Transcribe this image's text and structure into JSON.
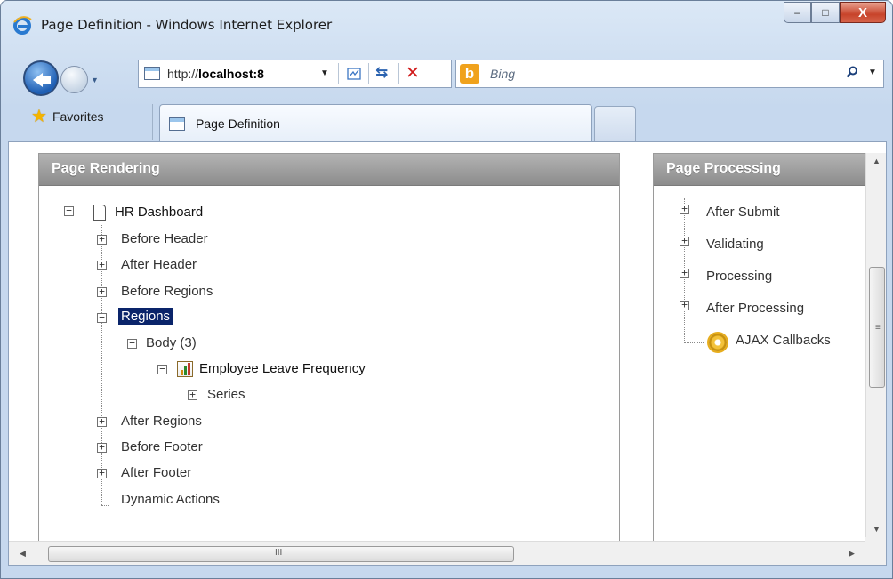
{
  "window": {
    "title": "Page Definition - Windows Internet Explorer",
    "minimize": "–",
    "maximize": "□",
    "close": "X"
  },
  "navigation": {
    "url_prefix": "http://",
    "url_host": "localhost:8",
    "search_placeholder": "Bing",
    "search_logo_letter": "b"
  },
  "favorites": {
    "label": "Favorites",
    "tab_label": "Page Definition"
  },
  "page_rendering": {
    "header": "Page Rendering",
    "root": "HR Dashboard",
    "items": [
      "Before Header",
      "After Header",
      "Before Regions",
      "Regions"
    ],
    "region_child": "Body (3)",
    "region_grandchild": "Employee Leave Frequency",
    "series": "Series",
    "after_items": [
      "After Regions",
      "Before Footer",
      "After Footer",
      "Dynamic Actions"
    ]
  },
  "page_processing": {
    "header": "Page Processing",
    "items": [
      "After Submit",
      "Validating",
      "Processing",
      "After Processing",
      "AJAX Callbacks"
    ]
  },
  "scrollbar": {
    "grip_v": "≡",
    "grip_h": "III"
  }
}
